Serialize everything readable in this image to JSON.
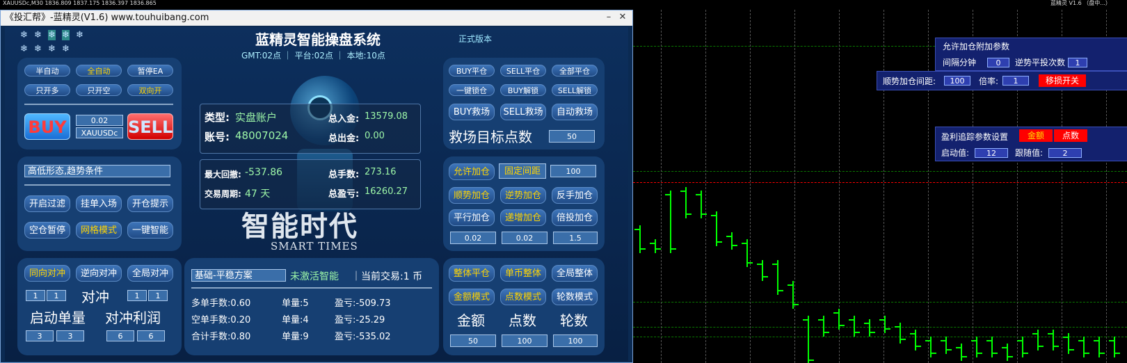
{
  "chart_info": {
    "symbol_line": "XAUUSDc,M30  1836.809  1837.175  1836.397  1836.865",
    "ea_badge": "蓝精灵 V1.6 （盘中...）"
  },
  "window": {
    "title": "《投汇帮》-蓝精灵(V1.6) www.touhuibang.com",
    "minimize": "–",
    "close": "✕"
  },
  "header": {
    "system_title": "蓝精灵智能操盘系统",
    "edition": "正式版本",
    "time_line": "GMT:02点 ｜ 平台:02点 ｜ 本地:10点"
  },
  "left_top": {
    "buttons": [
      "半自动",
      "全自动",
      "暂停EA",
      "只开多",
      "只开空",
      "双向开"
    ],
    "active": [
      false,
      true,
      false,
      false,
      false,
      true
    ],
    "buy": "BUY",
    "sell": "SELL",
    "lot": "0.02",
    "symbol": "XAUUSDc"
  },
  "left_mid": {
    "condition": "高低形态,趋势条件",
    "buttons": [
      "开启过滤",
      "挂单入场",
      "开仓提示",
      "空仓暂停",
      "网格模式",
      "一键智能"
    ],
    "active": [
      false,
      false,
      false,
      false,
      true,
      false
    ]
  },
  "left_bottom": {
    "buttons": [
      "同向对冲",
      "逆向对冲",
      "全局对冲"
    ],
    "active": [
      true,
      false,
      false
    ],
    "hedge_label": "对冲",
    "start_lot_label": "启动单量",
    "hedge_profit_label": "对冲利润",
    "v1": [
      "1",
      "1"
    ],
    "v2": [
      "1",
      "1"
    ],
    "v3": [
      "3",
      "3"
    ],
    "v4": [
      "6",
      "6"
    ]
  },
  "account": {
    "type_label": "类型:",
    "type_value": "实盘账户",
    "acct_label": "账号:",
    "acct_value": "48007024",
    "deposit_label": "总入金:",
    "deposit_value": "13579.08",
    "withdraw_label": "总出金:",
    "withdraw_value": "0.00",
    "dd_label": "最大回撤:",
    "dd_value": "-537.86",
    "period_label": "交易周期:",
    "period_value": "47 天",
    "lots_label": "总手数:",
    "lots_value": "273.16",
    "profit_label": "总盈亏:",
    "profit_value": "16260.27"
  },
  "logo": {
    "cn": "智能时代",
    "en": "SMART TIMES"
  },
  "plan": {
    "plan_name": "基础-平稳方案",
    "activation": "未激活智能",
    "current": "｜当前交易:1 币",
    "rows": [
      {
        "a": "多单手数:0.60",
        "b": "单量:5",
        "c": "盈亏:-509.73"
      },
      {
        "a": "空单手数:0.20",
        "b": "单量:4",
        "c": "盈亏:-25.29"
      },
      {
        "a": "合计手数:0.80",
        "b": "单量:9",
        "c": "盈亏:-535.02"
      }
    ]
  },
  "right_top": {
    "buttons": [
      "BUY平仓",
      "SELL平仓",
      "全部平仓",
      "一键锁仓",
      "BUY解锁",
      "SELL解锁",
      "BUY救场",
      "SELL救场",
      "自动救场"
    ],
    "rescue_label": "救场目标点数",
    "rescue_value": "50"
  },
  "right_mid": {
    "buttons": [
      "允许加仓",
      "固定间距",
      "顺势加仓",
      "逆势加仓",
      "反手加仓",
      "平行加仓",
      "递增加仓",
      "倍投加仓"
    ],
    "active": [
      true,
      true,
      true,
      true,
      false,
      false,
      true,
      false
    ],
    "grid_value": "100",
    "v1": "0.02",
    "v2": "0.02",
    "v3": "1.5"
  },
  "right_bottom": {
    "buttons": [
      "整体平仓",
      "单币整体",
      "全局整体",
      "金额模式",
      "点数模式",
      "轮数模式"
    ],
    "active": [
      true,
      true,
      false,
      true,
      true,
      false
    ],
    "labels": [
      "金额",
      "点数",
      "轮数"
    ],
    "values": [
      "50",
      "100",
      "100"
    ]
  },
  "side_panels": {
    "p1_title": "允许加仓附加参数",
    "p1_interval": "间隔分钟",
    "p1_interval_v": "0",
    "p1_reverse": "逆势平投次数",
    "p1_reverse_v": "1",
    "p2_label": "顺势加仓间距:",
    "p2_v": "100",
    "p2_rate": "倍率:",
    "p2_rate_v": "1",
    "p2_btn": "移损开关",
    "p3_title": "盈利追踪参数设置",
    "p3_amount": "金额",
    "p3_points": "点数",
    "p3_start": "启动值:",
    "p3_start_v": "12",
    "p3_follow": "跟随值:",
    "p3_follow_v": "2"
  },
  "colors": {
    "panel_bg": "#163f72",
    "candle": "#00ff00",
    "grid": "#0a7a00",
    "level_red": "#ff0000"
  }
}
